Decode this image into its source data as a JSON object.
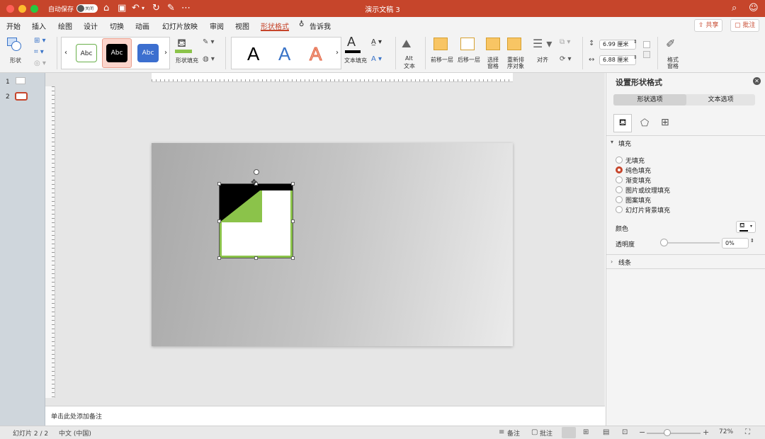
{
  "titlebar": {
    "autosave_label": "自动保存",
    "autosave_state": "关闭",
    "doc_title": "演示文稿 3"
  },
  "tabs": [
    "开始",
    "插入",
    "绘图",
    "设计",
    "切换",
    "动画",
    "幻灯片放映",
    "审阅",
    "视图",
    "形状格式",
    "告诉我"
  ],
  "share": {
    "share_label": "共享",
    "comment_label": "批注"
  },
  "ribbon": {
    "shape_label": "形状",
    "style_abc": "Abc",
    "fill_label": "形状填充",
    "wordart_letter": "A",
    "text_fill_label": "文本填充",
    "alt_text_label_line1": "Alt",
    "alt_text_label_line2": "文本",
    "bring_forward": "前移一层",
    "send_backward": "后移一层",
    "selection_pane_line1": "选择",
    "selection_pane_line2": "窗格",
    "reorder_line1": "重新排",
    "reorder_line2": "序对象",
    "align_label": "对齐",
    "height_value": "6.99 厘米",
    "width_value": "6.88 厘米",
    "format_pane_line1": "格式",
    "format_pane_line2": "窗格"
  },
  "thumbs": {
    "slide1": "1",
    "slide2": "2"
  },
  "notes_placeholder": "单击此处添加备注",
  "panel": {
    "title": "设置形状格式",
    "tab_shape": "形状选项",
    "tab_text": "文本选项",
    "fill_section": "填充",
    "fill_options": [
      "无填充",
      "纯色填充",
      "渐变填充",
      "图片或纹理填充",
      "图案填充",
      "幻灯片背景填充"
    ],
    "selected_index": 1,
    "color_label": "颜色",
    "transparency_label": "透明度",
    "transparency_value": "0%",
    "line_section": "线条"
  },
  "status": {
    "slide_info": "幻灯片 2 / 2",
    "language": "中文 (中国)",
    "notes_label": "备注",
    "comments_label": "批注",
    "zoom": "72%"
  },
  "colors": {
    "accent": "#c6452b",
    "shape_green": "#8bc34a",
    "shape_black": "#000000"
  }
}
